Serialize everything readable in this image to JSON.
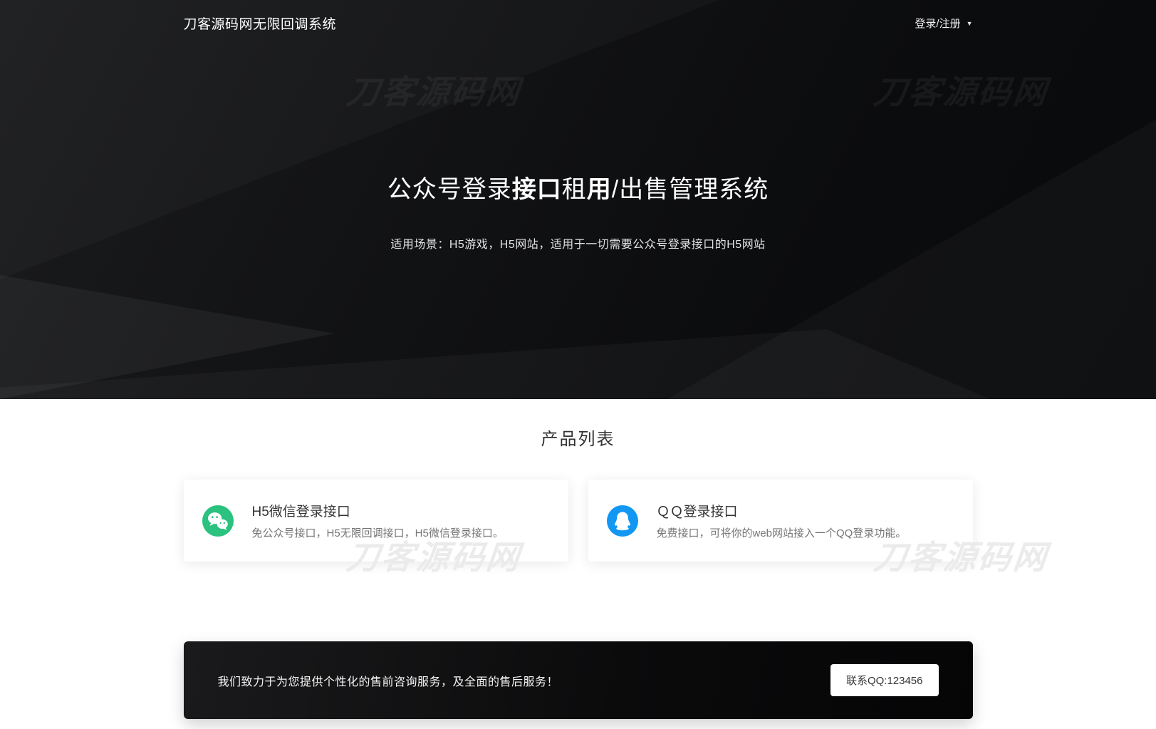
{
  "header": {
    "brand": "刀客源码网无限回调系统",
    "login_label": "登录/注册",
    "caret_icon": "▼"
  },
  "hero": {
    "title_segments": [
      {
        "text": "公众号登录",
        "bold": false
      },
      {
        "text": "接口",
        "bold": true
      },
      {
        "text": "租",
        "bold": false
      },
      {
        "text": "用",
        "bold": true
      },
      {
        "text": "/出售管理系统",
        "bold": false
      }
    ],
    "subtitle": "适用场景：H5游戏，H5网站，适用于一切需要公众号登录接口的H5网站",
    "watermark": "刀客源码网"
  },
  "products": {
    "section_title": "产品列表",
    "watermark": "刀客源码网",
    "cards": [
      {
        "icon": "wechat-icon",
        "icon_color": "#2bc17e",
        "title": "H5微信登录接口",
        "desc": "免公众号接口，H5无限回调接口，H5微信登录接口。"
      },
      {
        "icon": "qq-icon",
        "icon_color": "#1297f3",
        "title": "ＱＱ登录接口",
        "desc": "免费接口，可将你的web网站接入一个QQ登录功能。"
      }
    ]
  },
  "footer": {
    "message": "我们致力于为您提供个性化的售前咨询服务，及全面的售后服务！",
    "contact_button": "联系QQ:123456"
  },
  "colors": {
    "hero_bg": "#0e0f11",
    "accent_wechat": "#2bc17e",
    "accent_qq": "#1297f3",
    "footer_bg": "#0b0b0c"
  }
}
